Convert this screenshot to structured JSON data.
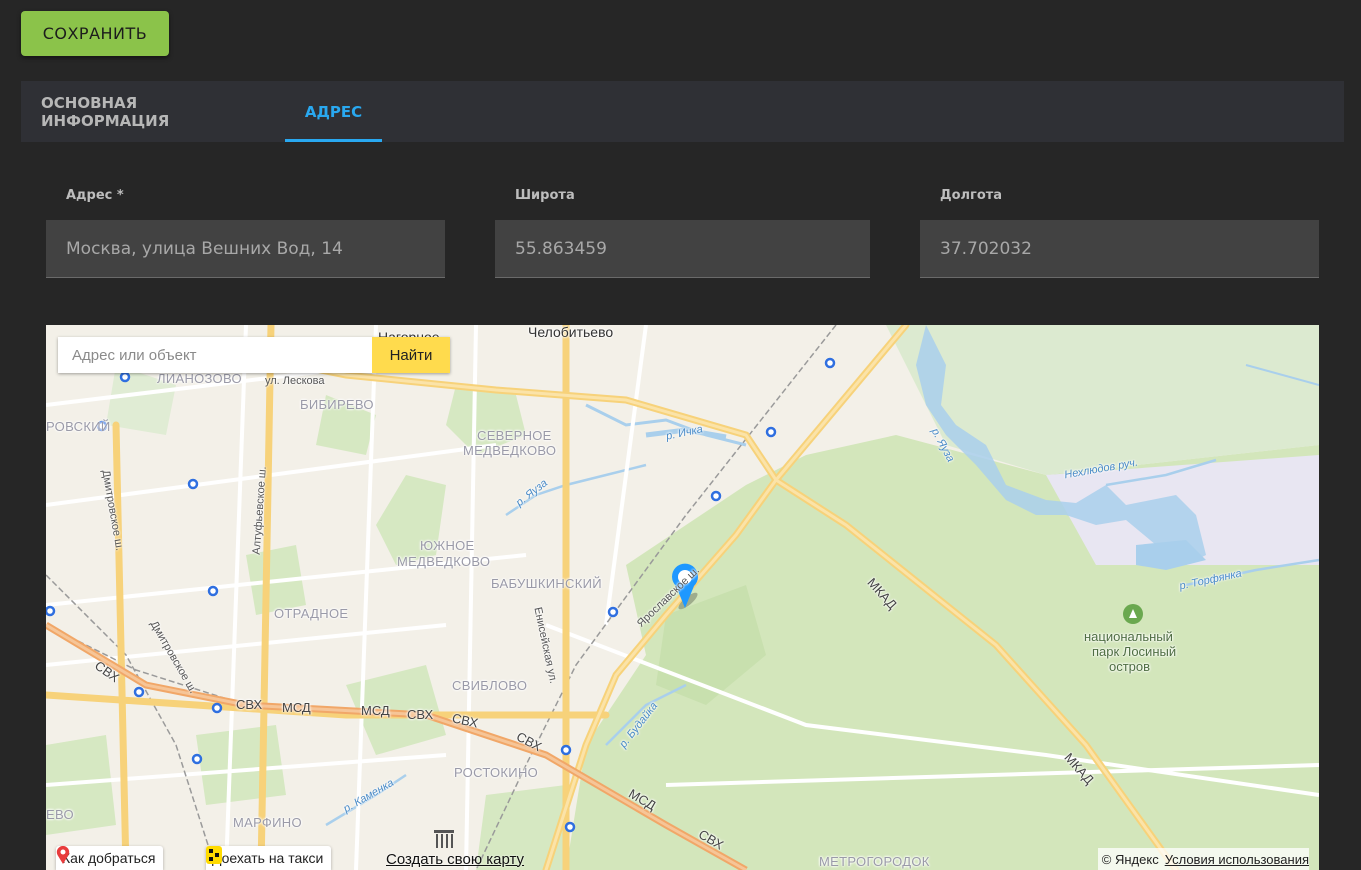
{
  "toolbar": {
    "save_label": "СОХРАНИТЬ"
  },
  "tabs": [
    {
      "label": "ОСНОВНАЯ ИНФОРМАЦИЯ",
      "active": false
    },
    {
      "label": "АДРЕС",
      "active": true
    }
  ],
  "form": {
    "address": {
      "label": "Адрес *",
      "value": "Москва, улица Вешних Вод, 14"
    },
    "latitude": {
      "label": "Широта",
      "value": "55.863459"
    },
    "longitude": {
      "label": "Долгота",
      "value": "37.702032"
    }
  },
  "map": {
    "search_placeholder": "Адрес или объект",
    "search_button": "Найти",
    "labels": {
      "nagornoe": "Нагорное",
      "chelobitevo": "Челобитьево",
      "lianozovo": "ЛИАНОЗОВО",
      "leskova": "ул. Лескова",
      "bibirevo": "БИБИРЕВО",
      "rovsky": "РОВСКИЙ",
      "severnoe_1": "СЕВЕРНОЕ",
      "severnoe_2": "МЕДВЕДКОВО",
      "yuzhnoe_1": "ЮЖНОЕ",
      "yuzhnoe_2": "МЕДВЕДКОВО",
      "babushkinsky": "БАБУШКИНСКИЙ",
      "otradnoe": "ОТРАДНОЕ",
      "sviblovo": "СВИБЛОВО",
      "rostokino": "РОСТОКИНО",
      "marfino": "МАРФИНО",
      "evo": "ЕВО",
      "metrogorodok": "МЕТРОГОРОДОК",
      "ichka": "р. Ичка",
      "yauza_1": "р. Яуза",
      "yauza_2": "р. Яуза",
      "nekhlyudov": "Нехлюдов руч.",
      "torfyanka": "р. Торфянка",
      "budaika": "р. Будайка",
      "kamenka": "р. Каменка",
      "dmitrovskoe_1": "Дмитровское ш.",
      "dmitrovskoe_2": "Дмитровское ш.",
      "altufevskoe": "Алтуфьевское ш.",
      "eniseyskaya": "Енисейская ул.",
      "yaroslavskoe": "Ярославское ш.",
      "mkad_1": "МКАД",
      "mkad_2": "МКАД",
      "svh_1": "СВХ",
      "svh_2": "СВХ",
      "svh_3": "СВХ",
      "svh_4": "СВХ",
      "svh_5": "СВХ",
      "svh_6": "СВХ",
      "msd_1": "МСД",
      "msd_2": "МСД",
      "msd_3": "МСД",
      "park_1": "национальный",
      "park_2": "парк Лосиный",
      "park_3": "остров"
    },
    "footer": {
      "route": "Как добраться",
      "taxi": "Доехать на такси",
      "create": "Создать свою карту",
      "copyright": "© Яндекс",
      "terms": "Условия использования"
    }
  }
}
